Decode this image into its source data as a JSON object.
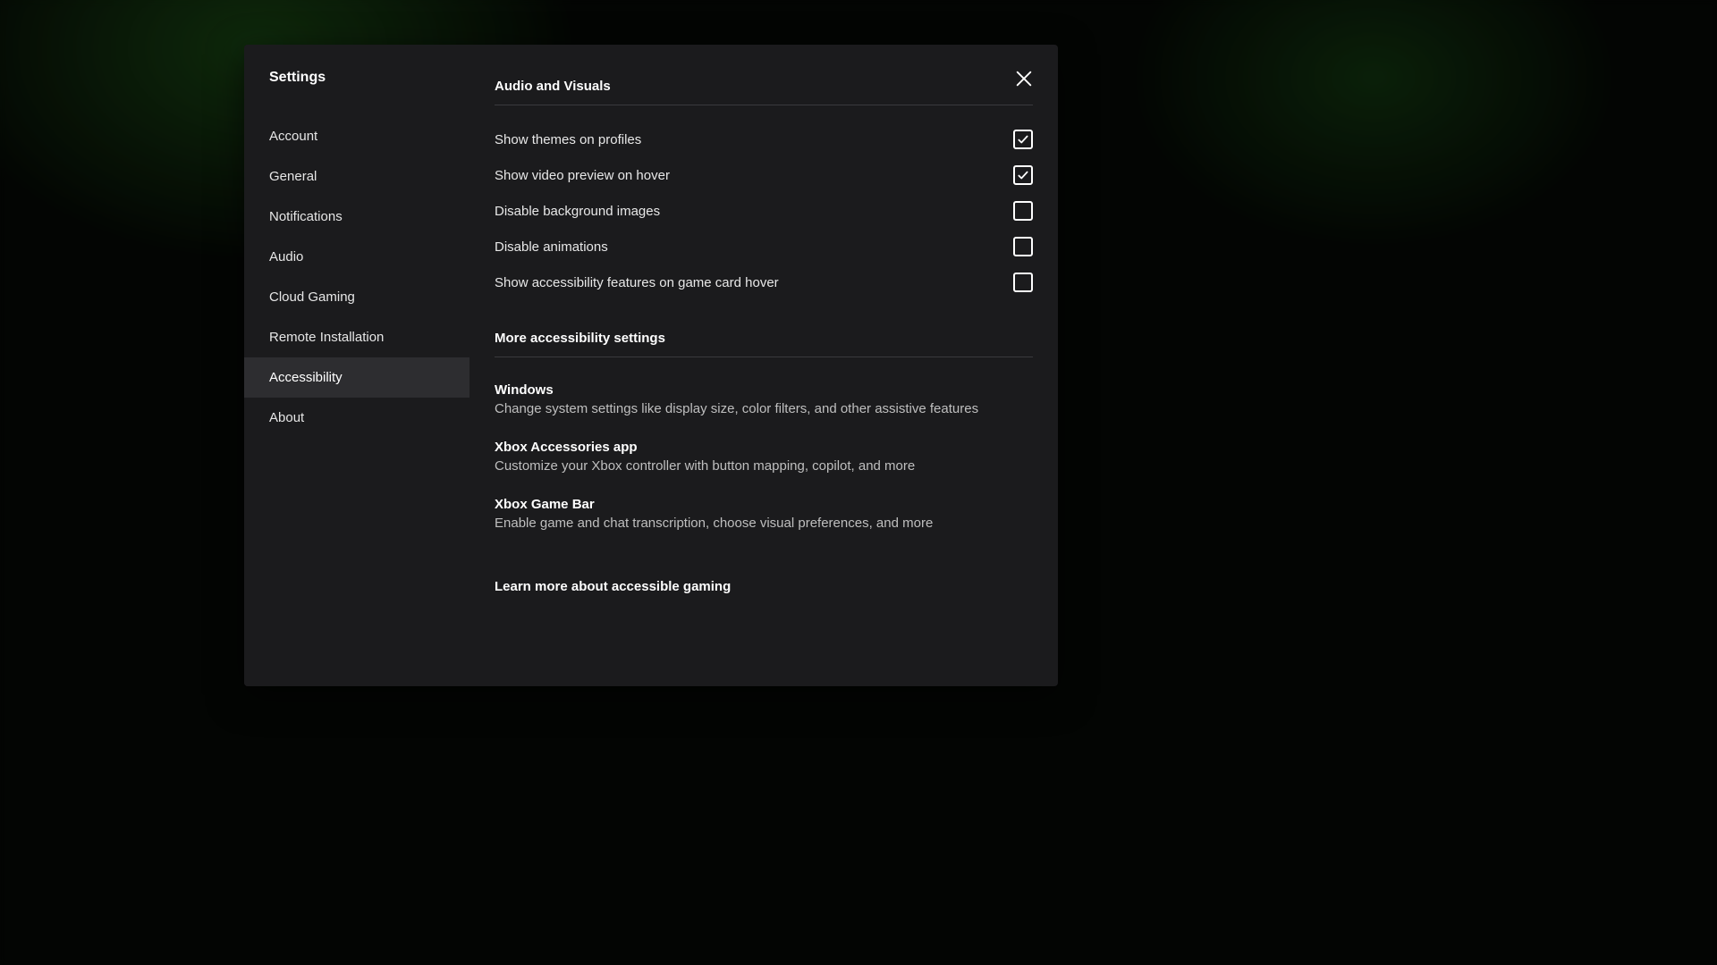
{
  "dialog": {
    "title": "Settings"
  },
  "nav": {
    "items": [
      {
        "label": "Account",
        "key": "account",
        "selected": false
      },
      {
        "label": "General",
        "key": "general",
        "selected": false
      },
      {
        "label": "Notifications",
        "key": "notifications",
        "selected": false
      },
      {
        "label": "Audio",
        "key": "audio",
        "selected": false
      },
      {
        "label": "Cloud Gaming",
        "key": "cloud-gaming",
        "selected": false
      },
      {
        "label": "Remote Installation",
        "key": "remote-installation",
        "selected": false
      },
      {
        "label": "Accessibility",
        "key": "accessibility",
        "selected": true
      },
      {
        "label": "About",
        "key": "about",
        "selected": false
      }
    ]
  },
  "sections": {
    "audio_visuals": {
      "title": "Audio and Visuals",
      "options": [
        {
          "label": "Show themes on profiles",
          "checked": true,
          "key": "show-themes-profiles"
        },
        {
          "label": "Show video preview on hover",
          "checked": true,
          "key": "show-video-preview"
        },
        {
          "label": "Disable background images",
          "checked": false,
          "key": "disable-background-images"
        },
        {
          "label": "Disable animations",
          "checked": false,
          "key": "disable-animations"
        },
        {
          "label": "Show accessibility features on game card hover",
          "checked": false,
          "key": "show-a11y-hover"
        }
      ]
    },
    "more_settings": {
      "title": "More accessibility settings",
      "links": [
        {
          "title": "Windows",
          "desc": "Change system settings like display size, color filters, and other assistive features",
          "key": "windows"
        },
        {
          "title": "Xbox Accessories app",
          "desc": "Customize your Xbox controller with button mapping, copilot, and more",
          "key": "xbox-accessories"
        },
        {
          "title": "Xbox Game Bar",
          "desc": "Enable game and chat transcription, choose visual preferences, and more",
          "key": "xbox-game-bar"
        }
      ]
    }
  },
  "footer": {
    "learn_more": "Learn more about accessible gaming"
  }
}
